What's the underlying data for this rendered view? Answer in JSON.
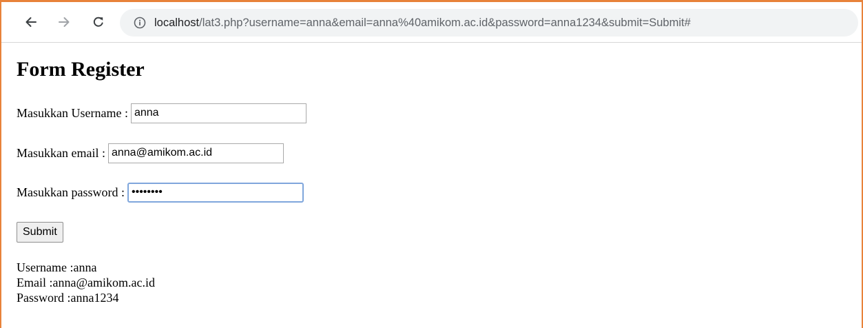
{
  "browser": {
    "url_host": "localhost",
    "url_path": "/lat3.php?username=anna&email=anna%40amikom.ac.id&password=anna1234&submit=Submit#"
  },
  "page": {
    "title": "Form Register",
    "form": {
      "username_label": "Masukkan Username :",
      "username_value": "anna",
      "email_label": "Masukkan email :",
      "email_value": "anna@amikom.ac.id",
      "password_label": "Masukkan password :",
      "password_value": "anna1234",
      "submit_label": "Submit"
    },
    "result": {
      "username": "Username :anna",
      "email": "Email :anna@amikom.ac.id",
      "password": "Password :anna1234"
    }
  },
  "colors": {
    "window_accent": "#e8823a",
    "focus_border": "#7fa6dc",
    "omnibox_bg": "#f1f3f4"
  },
  "icons": {
    "back": "arrow-left-icon",
    "forward": "arrow-right-icon",
    "reload": "reload-icon",
    "site_info": "info-circle-icon"
  }
}
